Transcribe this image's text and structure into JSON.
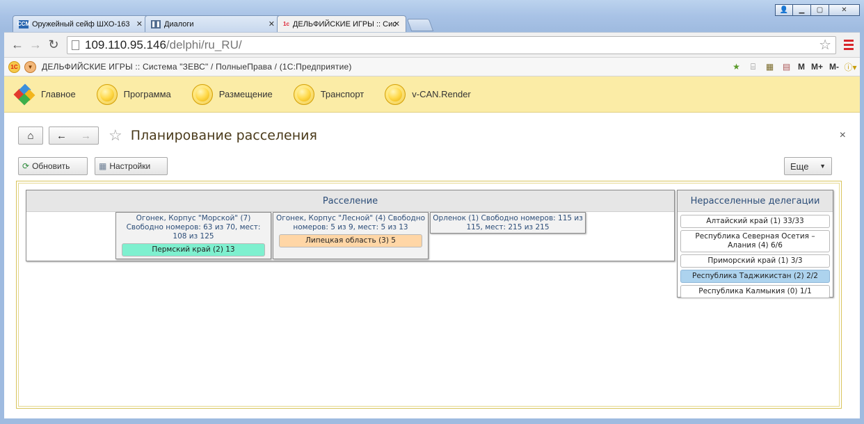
{
  "browser": {
    "tabs": [
      {
        "icon": "CCM",
        "title": "Оружейный сейф ШХО-163",
        "close": "✕"
      },
      {
        "icon": "❚❚",
        "title": "Диалоги",
        "close": "✕"
      },
      {
        "icon": "1c",
        "title": "ДЕЛЬФИЙСКИЕ ИГРЫ :: Сис",
        "close": "✕"
      }
    ],
    "url_host": "109.110.95.146",
    "url_path": "/delphi/ru_RU/"
  },
  "app": {
    "title": "ДЕЛЬФИЙСКИЕ ИГРЫ :: Система \"ЗЕВС\" / ПолныеПрава / (1С:Предприятие)",
    "mem_buttons": [
      "M",
      "M+",
      "M-"
    ]
  },
  "sections": [
    {
      "label": "Главное",
      "icon": "main-logo-icon"
    },
    {
      "label": "Программа",
      "icon": "coin-icon"
    },
    {
      "label": "Размещение",
      "icon": "coin-icon"
    },
    {
      "label": "Транспорт",
      "icon": "coin-icon"
    },
    {
      "label": "v-CAN.Render",
      "icon": "coin-icon"
    }
  ],
  "form": {
    "title": "Планирование расселения",
    "close": "×",
    "refresh_label": "Обновить",
    "settings_label": "Настройки",
    "more_label": "Еще"
  },
  "settlement": {
    "header": "Расселение",
    "buildings": [
      {
        "name": "Огонек, Корпус \"Морской\" (7) Свободно номеров: 63 из 70, мест: 108 из 125",
        "delegation": "Пермский край (2) 13",
        "chip_color": "#7ef0cf"
      },
      {
        "name": "Огонек, Корпус \"Лесной\" (4) Свободно номеров: 5 из 9, мест: 5 из 13",
        "delegation": "Липецкая область (3) 5",
        "chip_color": "#ffd6a6"
      },
      {
        "name": "Орленок (1) Свободно номеров: 115 из 115, мест: 215 из 215",
        "delegation": null,
        "chip_color": null
      }
    ]
  },
  "unsettled": {
    "header": "Нерасселенные делегации",
    "items": [
      {
        "label": "Алтайский край (1) 33/33",
        "selected": false
      },
      {
        "label": "Республика Северная Осетия – Алания (4) 6/6",
        "selected": false
      },
      {
        "label": "Приморский край (1) 3/3",
        "selected": false
      },
      {
        "label": "Республика Таджикистан (2) 2/2",
        "selected": true
      },
      {
        "label": "Республика Калмыкия (0) 1/1",
        "selected": false
      }
    ],
    "selected_color": "#add3ee"
  }
}
